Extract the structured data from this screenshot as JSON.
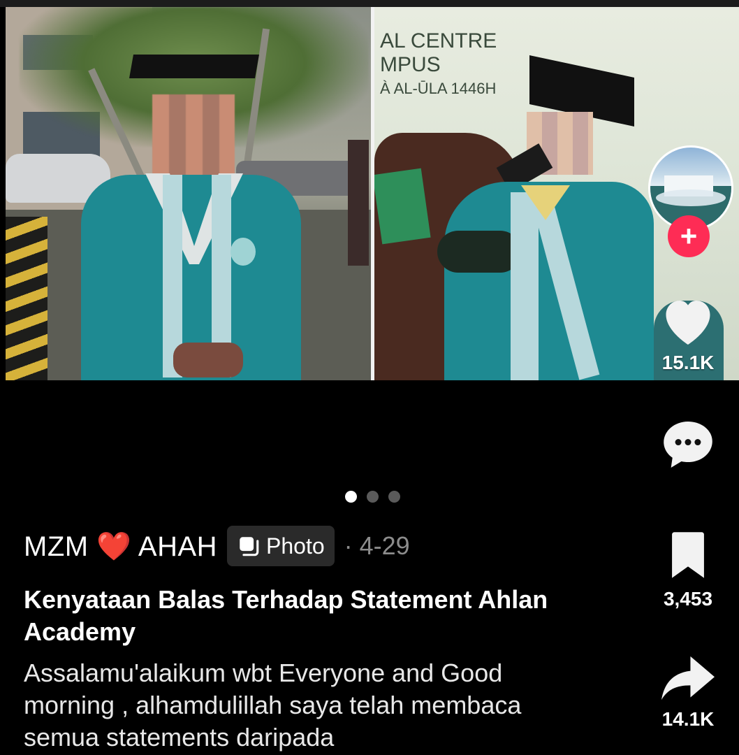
{
  "post": {
    "author": "MZM ❤️ AHAH",
    "type_badge": "Photo",
    "date": "· 4-29",
    "title": "Kenyataan Balas Terhadap Statement Ahlan Academy",
    "description": "Assalamu'alaikum wbt Everyone and Good morning , alhamdulillah saya telah membaca semua statements daripada"
  },
  "photo_right_sign": {
    "line1": "AL CENTRE",
    "line2": "MPUS",
    "line3": "À AL-ŪLA 1446H"
  },
  "carousel": {
    "total": 3,
    "active_index": 0
  },
  "actions": {
    "likes": "15.1K",
    "bookmarks": "3,453",
    "shares": "14.1K",
    "follow_symbol": "+"
  },
  "colors": {
    "follow_accent": "#fe2c55",
    "background": "#000000",
    "gown_teal": "#1e8a92"
  }
}
